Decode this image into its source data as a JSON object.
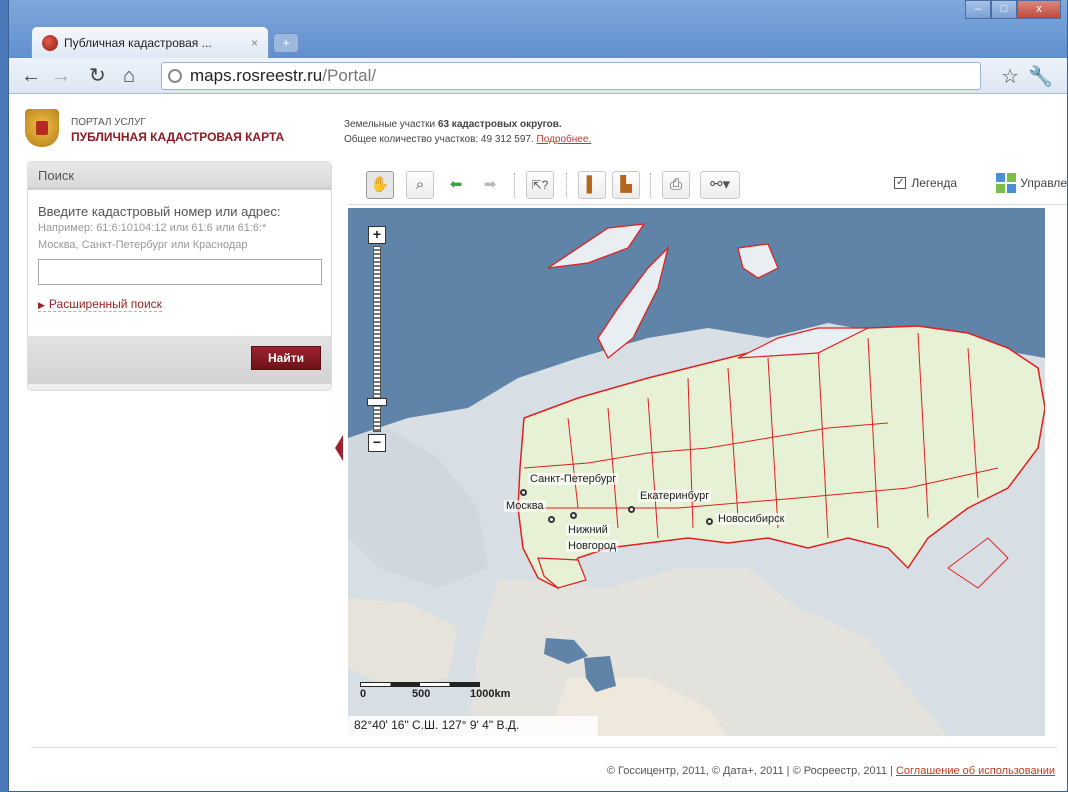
{
  "browser": {
    "tab_title": "Публичная кадастровая ...",
    "tab_close": "×",
    "new_tab": "+",
    "url_host": "maps.rosreestr.ru",
    "url_path": "/Portal/",
    "window_controls": {
      "minimize": "–",
      "maximize": "□",
      "close": "x"
    }
  },
  "header": {
    "portal_sub": "ПОРТАЛ УСЛУГ",
    "portal_title": "ПУБЛИЧНАЯ КАДАСТРОВАЯ КАРТА",
    "stats_prefix": "Земельные участки ",
    "stats_bold": "63 кадастровых округов.",
    "stats_line2": "Общее количество участков: 49 312 597. ",
    "stats_more": "Подробнее."
  },
  "search": {
    "title": "Поиск",
    "prompt": "Введите кадастровый номер или адрес:",
    "hint1": "Например: 61:6:10104:12 или 61:6 или 61:6:*",
    "hint2": "Москва, Санкт-Петербург или Краснодар",
    "input_value": "",
    "advanced_label": "Расширенный поиск",
    "find_button": "Найти"
  },
  "map_toolbar": {
    "legend_label": "Легенда",
    "legend_checked": "✓",
    "manage_label": "Управле"
  },
  "map": {
    "cities": {
      "spb": "Санкт-Петербург",
      "moscow": "Москва",
      "nn1": "Нижний",
      "nn2": "Новгород",
      "ekb": "Екатеринбург",
      "nsk": "Новосибирск"
    },
    "scale": {
      "s0": "0",
      "s500": "500",
      "s1000": "1000km"
    },
    "coords": "82°40' 16\"  С.Ш.     127° 9' 4\"     В.Д."
  },
  "footer": {
    "copyright": "© Госсицентр, 2011, © Дата+, 2011 | © Росреестр, 2011 | ",
    "agreement": "Соглашение об использовании"
  },
  "colors": {
    "brand": "#8b1c22",
    "boundary": "#e02020",
    "russia_fill": "#e6f1d6"
  }
}
